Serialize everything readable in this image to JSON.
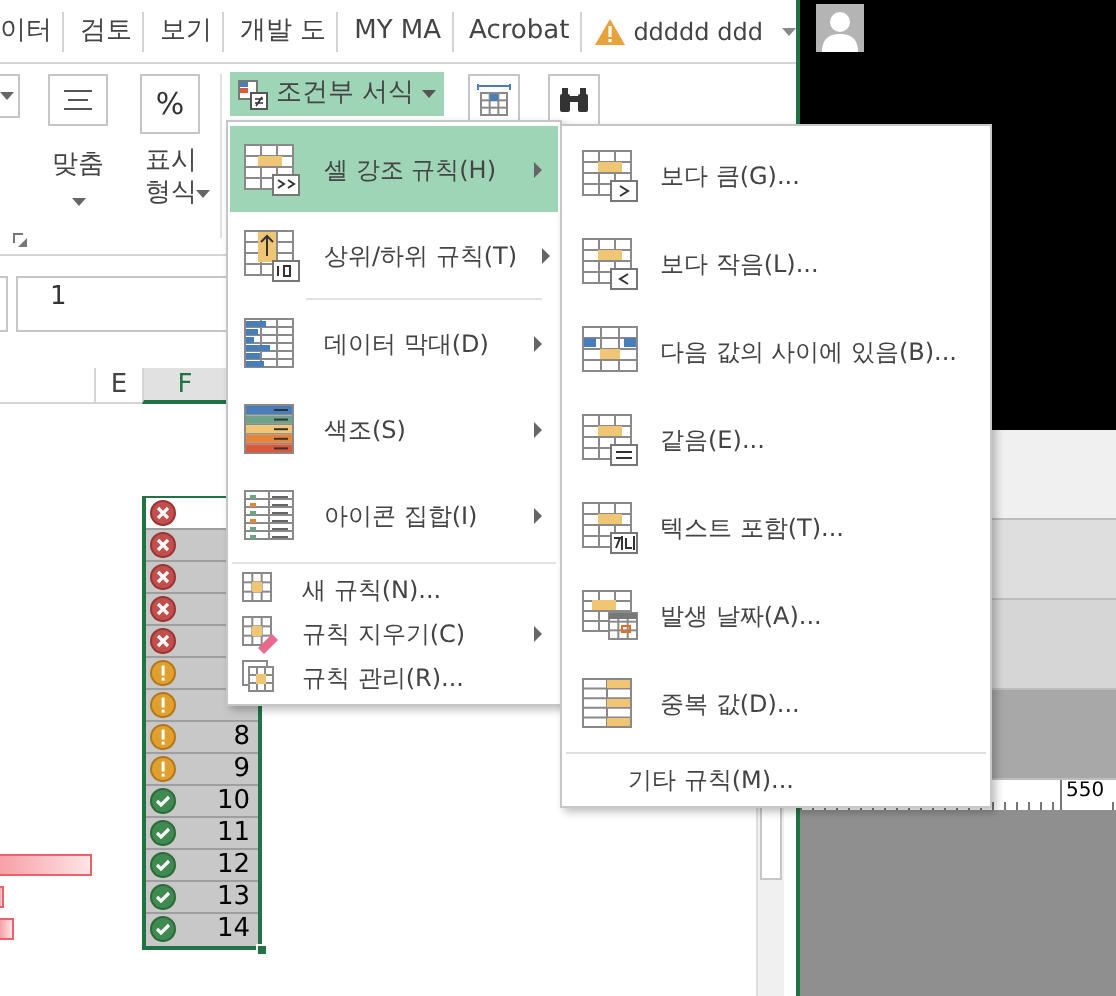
{
  "ribbon_tabs": [
    {
      "label": "이터"
    },
    {
      "label": "검토"
    },
    {
      "label": "보기"
    },
    {
      "label": "개발 도"
    },
    {
      "label": "MY MA"
    },
    {
      "label": "Acrobat"
    }
  ],
  "account": {
    "name": "ddddd ddd",
    "warning": true
  },
  "ribbon": {
    "groups": [
      {
        "label": "맞춤"
      },
      {
        "label": "표시 형식",
        "icon_text": "%"
      }
    ],
    "conditional_formatting": {
      "label": "조건부 서식",
      "expanded": true
    }
  },
  "formula_bar": {
    "value": "1"
  },
  "columns": [
    {
      "label": "E",
      "selected": false
    },
    {
      "label": "F",
      "selected": true
    }
  ],
  "cells": [
    {
      "kind": "error",
      "active": true
    },
    {
      "kind": "error",
      "active": false
    },
    {
      "kind": "error",
      "active": false
    },
    {
      "kind": "error",
      "active": false
    },
    {
      "kind": "error",
      "active": false
    },
    {
      "kind": "warning",
      "active": false
    },
    {
      "kind": "warning",
      "active": false
    },
    {
      "kind": "warning",
      "active": false,
      "value": "8"
    },
    {
      "kind": "warning",
      "active": false,
      "value": "9"
    },
    {
      "kind": "ok",
      "active": false,
      "value": "10"
    },
    {
      "kind": "ok",
      "active": false,
      "value": "11"
    },
    {
      "kind": "ok",
      "active": false,
      "value": "12"
    },
    {
      "kind": "ok",
      "active": false,
      "value": "13"
    },
    {
      "kind": "ok",
      "active": false,
      "value": "14"
    }
  ],
  "menu": {
    "items": [
      {
        "kind": "large",
        "label": "셀 강조 규칙(H)",
        "has_submenu": true,
        "selected": true
      },
      {
        "kind": "large",
        "label": "상위/하위 규칙(T)",
        "has_submenu": true,
        "selected": false
      },
      {
        "kind": "large",
        "label": "데이터 막대(D)",
        "has_submenu": true,
        "selected": false
      },
      {
        "kind": "large",
        "label": "색조(S)",
        "has_submenu": true,
        "selected": false
      },
      {
        "kind": "large",
        "label": "아이콘 집합(I)",
        "has_submenu": true,
        "selected": false
      },
      {
        "kind": "small",
        "label": "새 규칙(N)...",
        "has_submenu": false,
        "selected": false
      },
      {
        "kind": "small",
        "label": "규칙 지우기(C)",
        "has_submenu": true,
        "selected": false
      },
      {
        "kind": "small",
        "label": "규칙 관리(R)...",
        "has_submenu": false,
        "selected": false
      }
    ]
  },
  "submenu": {
    "items": [
      {
        "label": "보다 큼(G)..."
      },
      {
        "label": "보다 작음(L)..."
      },
      {
        "label": "다음 값의 사이에 있음(B)..."
      },
      {
        "label": "같음(E)..."
      },
      {
        "label": "텍스트 포함(T)..."
      },
      {
        "label": "발생 날짜(A)..."
      },
      {
        "label": "중복 값(D)..."
      }
    ],
    "footer": "기타 규칙(M)..."
  },
  "ruler": {
    "label": "550"
  }
}
